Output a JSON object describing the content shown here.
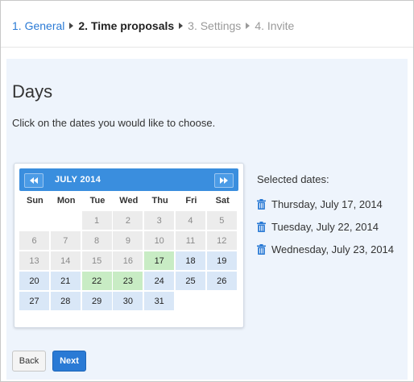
{
  "wizard": {
    "steps": [
      {
        "label": "1. General",
        "state": "done"
      },
      {
        "label": "2. Time proposals",
        "state": "active"
      },
      {
        "label": "3. Settings",
        "state": "future"
      },
      {
        "label": "4. Invite",
        "state": "future"
      }
    ]
  },
  "page": {
    "title": "Days",
    "instructions": "Click on the dates you would like to choose."
  },
  "calendar": {
    "month_label": "JULY 2014",
    "weekdays": [
      "Sun",
      "Mon",
      "Tue",
      "Wed",
      "Thu",
      "Fri",
      "Sat"
    ],
    "weeks": [
      [
        "",
        "",
        "1",
        "2",
        "3",
        "4",
        "5"
      ],
      [
        "6",
        "7",
        "8",
        "9",
        "10",
        "11",
        "12"
      ],
      [
        "13",
        "14",
        "15",
        "16",
        "17",
        "18",
        "19"
      ],
      [
        "20",
        "21",
        "22",
        "23",
        "24",
        "25",
        "26"
      ],
      [
        "27",
        "28",
        "29",
        "30",
        "31",
        "",
        ""
      ]
    ],
    "states": [
      [
        "empty",
        "empty",
        "past",
        "past",
        "past",
        "past",
        "past"
      ],
      [
        "past",
        "past",
        "past",
        "past",
        "past",
        "past",
        "past"
      ],
      [
        "past",
        "past",
        "past",
        "past",
        "sel",
        "avail",
        "avail"
      ],
      [
        "avail",
        "avail",
        "sel",
        "sel",
        "avail",
        "avail",
        "avail"
      ],
      [
        "avail",
        "avail",
        "avail",
        "avail",
        "avail",
        "empty",
        "empty"
      ]
    ],
    "colors": {
      "header": "#3a8ede",
      "past": "#ececec",
      "available": "#d9e7f7",
      "selected": "#c8ecc4"
    }
  },
  "selected": {
    "title": "Selected dates:",
    "icon": "trash-icon",
    "dates": [
      "Thursday, July 17, 2014",
      "Tuesday, July 22, 2014",
      "Wednesday, July 23, 2014"
    ]
  },
  "buttons": {
    "back": "Back",
    "next": "Next",
    "accent": "#2a7ad5"
  }
}
